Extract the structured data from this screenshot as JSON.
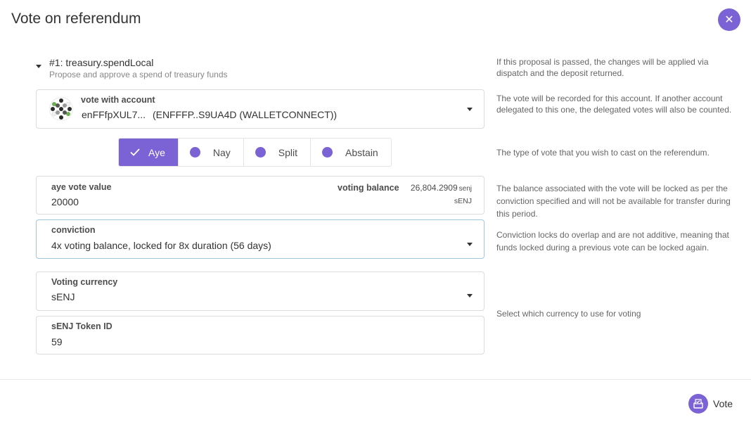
{
  "modal": {
    "title": "Vote on referendum",
    "close_icon": "close-icon"
  },
  "proposal": {
    "title": "#1: treasury.spendLocal",
    "subtitle": "Propose and approve a spend of treasury funds"
  },
  "account": {
    "label": "vote with account",
    "name": "enFFfpXUL7...",
    "detail": "(ENFFFP..S9UA4D (WALLETCONNECT))"
  },
  "vote_options": [
    {
      "label": "Aye",
      "active": true
    },
    {
      "label": "Nay",
      "active": false
    },
    {
      "label": "Split",
      "active": false
    },
    {
      "label": "Abstain",
      "active": false
    }
  ],
  "amount": {
    "label": "aye vote value",
    "value": "20000",
    "balance_label": "voting balance",
    "balance_value": "26,804.2909",
    "balance_unit": "senj",
    "ticker": "sENJ"
  },
  "conviction": {
    "label": "conviction",
    "value": "4x voting balance, locked for 8x duration (56 days)"
  },
  "currency": {
    "label": "Voting currency",
    "value": "sENJ"
  },
  "token": {
    "label": "sENJ Token ID",
    "value": "59"
  },
  "help": {
    "proposal": "If this proposal is passed, the changes will be applied via dispatch and the deposit returned.",
    "account": "The vote will be recorded for this account. If another account delegated to this one, the delegated votes will also be counted.",
    "vote_type": "The type of vote that you wish to cast on the referendum.",
    "balance": "The balance associated with the vote will be locked as per the conviction specified and will not be available for transfer during this period.",
    "conviction": "Conviction locks do overlap and are not additive, meaning that funds locked during a previous vote can be locked again.",
    "currency": "Select which currency to use for voting"
  },
  "footer": {
    "vote_label": "Vote"
  },
  "colors": {
    "accent": "#7b63d6",
    "focus_border": "#9fc8dd"
  }
}
